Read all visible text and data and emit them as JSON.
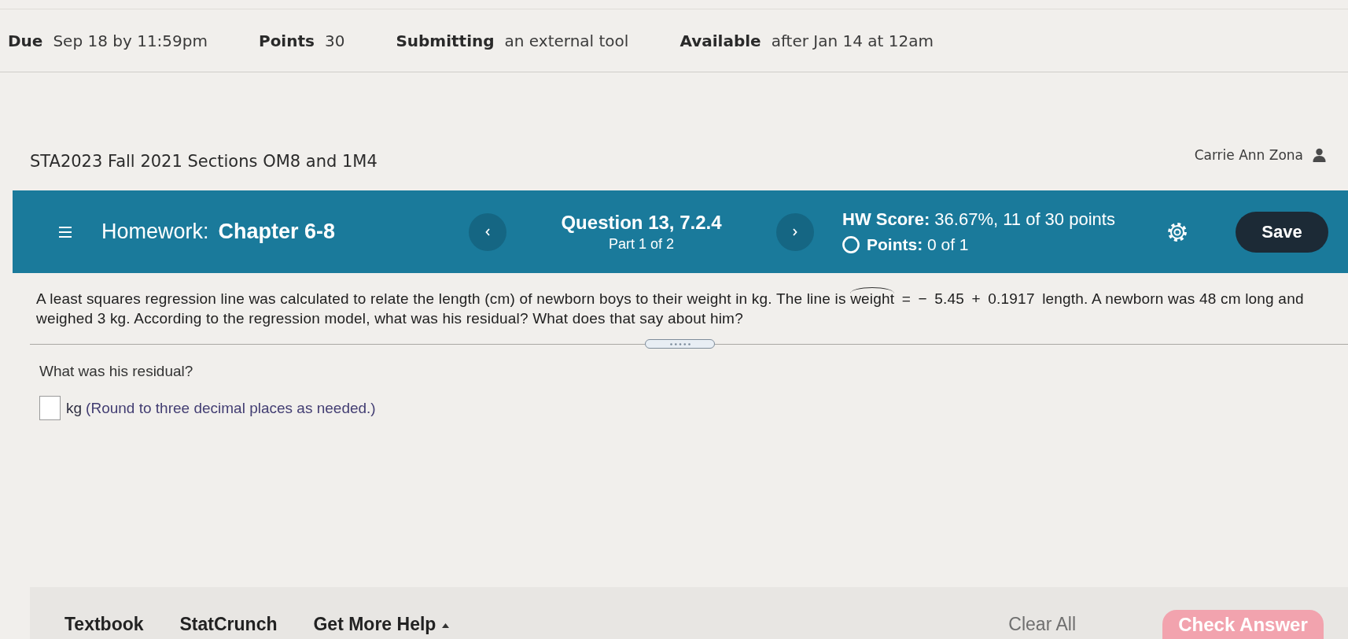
{
  "details": [
    {
      "label": "Due",
      "value": "Sep 18 by 11:59pm"
    },
    {
      "label": "Points",
      "value": "30"
    },
    {
      "label": "Submitting",
      "value": "an external tool"
    },
    {
      "label": "Available",
      "value": "after Jan 14 at 12am"
    }
  ],
  "course": {
    "title": "STA2023 Fall 2021 Sections OM8 and 1M4",
    "user": "Carrie Ann Zona"
  },
  "header": {
    "assignment_label": "Homework:",
    "assignment_name": "Chapter 6-8",
    "question": "Question 13, 7.2.4",
    "part": "Part 1 of 2",
    "hw_score": "**HW Score:** 36.67%, 11 of 30 points",
    "points": "**Points:** 0 of 1",
    "save": "Save"
  },
  "question": {
    "segments": [
      {
        "kind": "text",
        "text": "A least squares regression line was calculated to relate the length (cm) of newborn boys to their weight in kg. The line is "
      },
      {
        "kind": "hat",
        "text": "weight"
      },
      {
        "kind": "math",
        "text": " = − 5.45 + 0.1917 "
      },
      {
        "kind": "text",
        "text": "length. A newborn was 48 cm long and weighed 3 kg. According to the regression model, what was his residual? What does that say about him?"
      }
    ]
  },
  "prompt": "What was his residual?",
  "answer": {
    "unit": "kg",
    "hint": "(Round to three decimal places as needed.)"
  },
  "footer": {
    "links": [
      {
        "label": "Textbook",
        "kind": "link"
      },
      {
        "label": "StatCrunch",
        "kind": "link"
      },
      {
        "label": "Get More Help",
        "kind": "menu"
      }
    ],
    "clear": "Clear All",
    "check": {
      "label": "Check Answer",
      "disabled": true
    }
  }
}
